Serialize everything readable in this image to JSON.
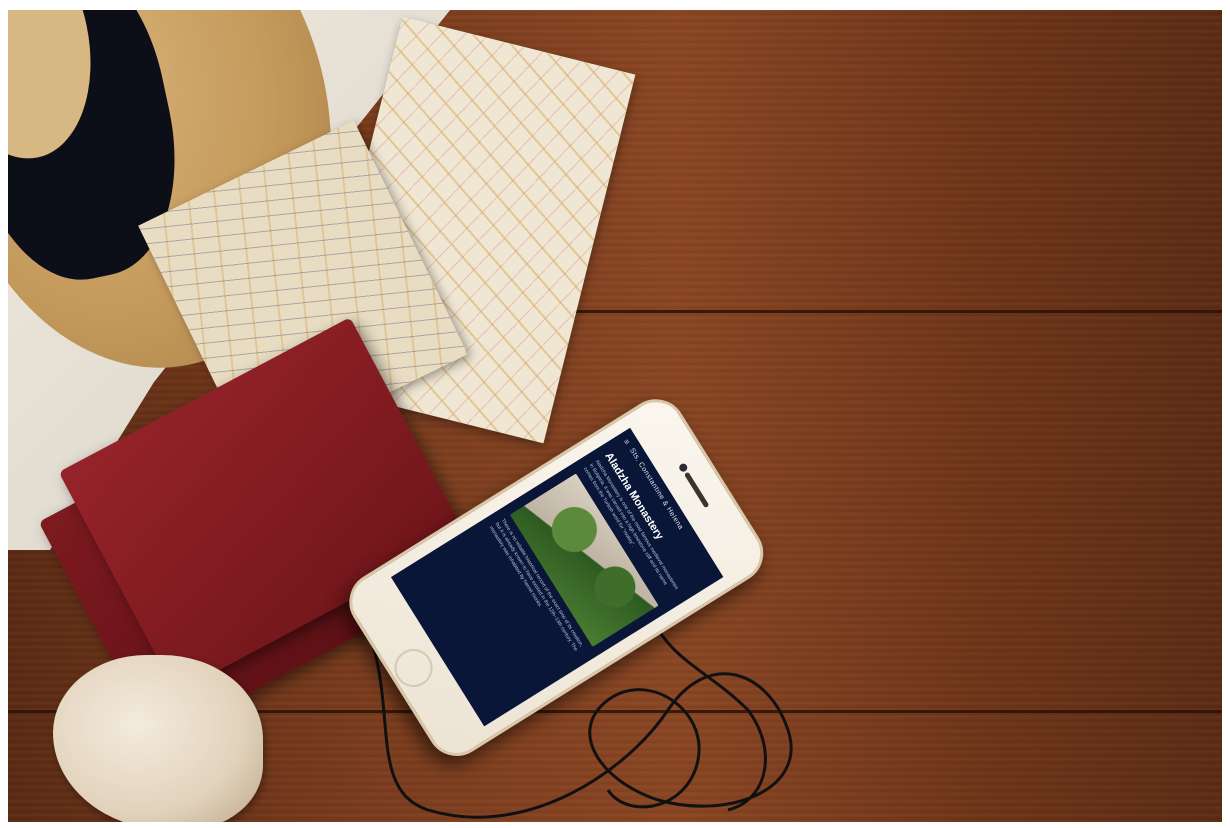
{
  "scene": {
    "objects": [
      "hat-icon",
      "tote-bag-icon",
      "map-icon",
      "passport-icon",
      "seashell-icon",
      "earphones-icon",
      "phone-icon"
    ]
  },
  "phone_app": {
    "header_title": "Sts. Constantine & Helena",
    "menu_icon": "menu-icon",
    "heading": "Aladzha Monastery",
    "paragraph_1": "Aladzha Monastery is one of the most famous medieval monasteries in Bulgaria. It was carved into a high limestone cliff and its name comes from the Turkish word for “motley”.",
    "paragraph_2": "There is no reliable historical record of the exact time of its creation, but it is already known to have existed in the 12th–13th century. The monastery was inhabited by hermit monks.",
    "colors": {
      "screen_bg": "#0a1638",
      "heading": "#ffffff",
      "body_text": "#b9c4de"
    }
  }
}
